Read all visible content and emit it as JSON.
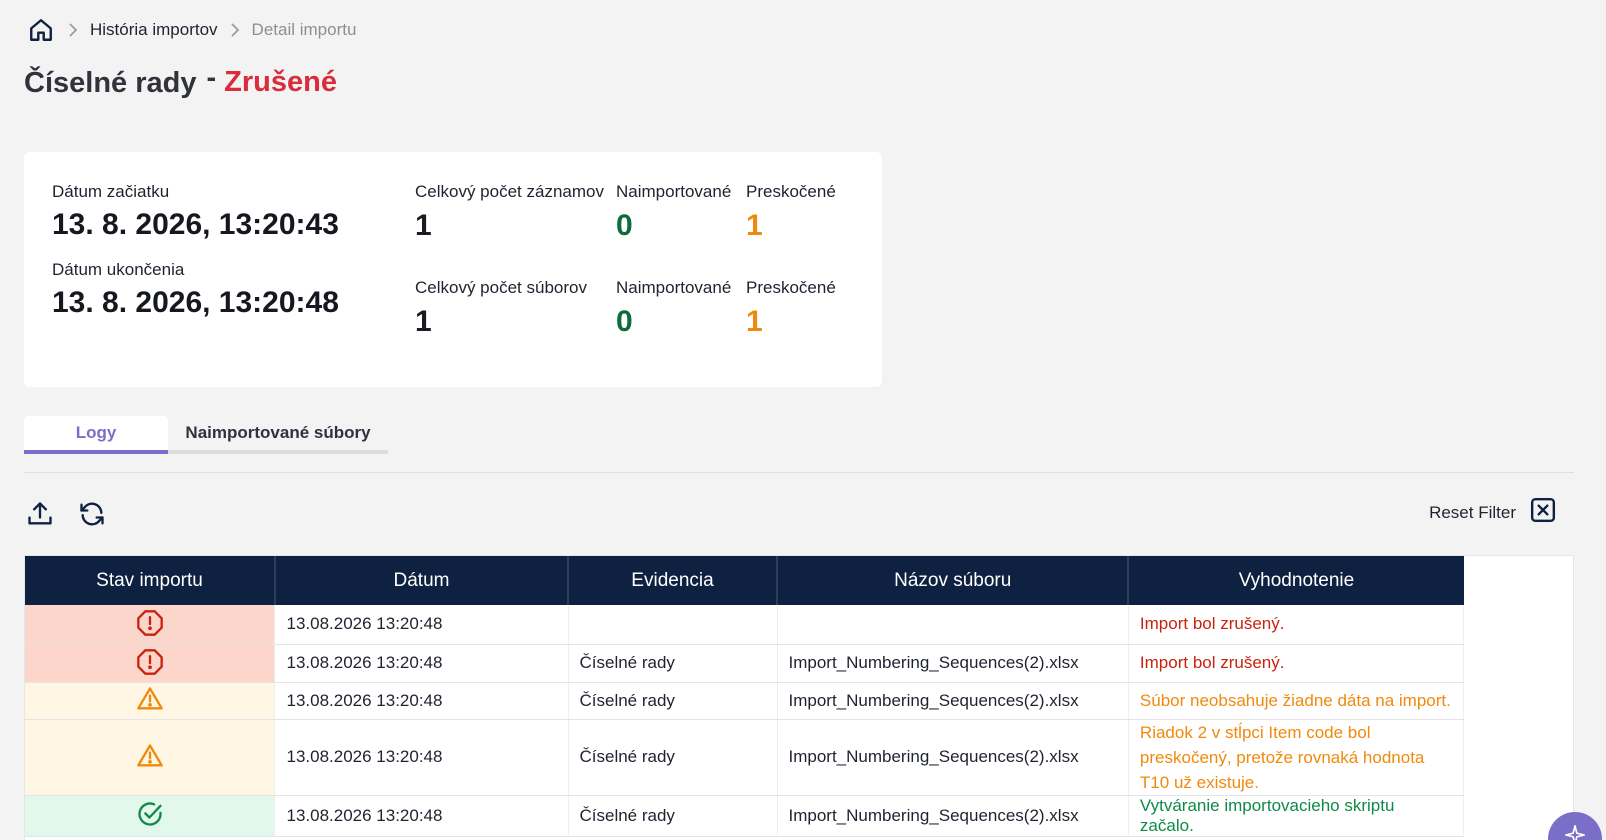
{
  "breadcrumb": {
    "home_icon": "home-icon",
    "items": [
      "História importov",
      "Detail importu"
    ]
  },
  "header": {
    "title": "Číselné rady",
    "separator": "-",
    "status": "Zrušené",
    "status_color": "#d92c3c"
  },
  "summary": {
    "start_label": "Dátum začiatku",
    "start_value": "13. 8. 2026, 13:20:43",
    "end_label": "Dátum ukončenia",
    "end_value": "13. 8. 2026, 13:20:48",
    "records": {
      "total_label": "Celkový počet záznamov",
      "total_value": "1",
      "imported_label": "Naimportované",
      "imported_value": "0",
      "skipped_label": "Preskočené",
      "skipped_value": "1"
    },
    "files": {
      "total_label": "Celkový počet súborov",
      "total_value": "1",
      "imported_label": "Naimportované",
      "imported_value": "0",
      "skipped_label": "Preskočené",
      "skipped_value": "1"
    }
  },
  "tabs": [
    {
      "label": "Logy",
      "active": true
    },
    {
      "label": "Naimportované súbory",
      "active": false
    }
  ],
  "toolbar": {
    "export_icon": "upload-icon",
    "refresh_icon": "refresh-icon",
    "reset_filter_label": "Reset Filter",
    "reset_icon": "close-square-icon"
  },
  "table": {
    "headers": [
      "Stav importu",
      "Dátum",
      "Evidencia",
      "Názov súboru",
      "Vyhodnotenie"
    ],
    "rows": [
      {
        "status": "error",
        "icon": "error-icon",
        "date": "13.08.2026 13:20:48",
        "evidencia": "",
        "file": "",
        "evaluation": "Import bol zrušený."
      },
      {
        "status": "error",
        "icon": "error-icon",
        "date": "13.08.2026 13:20:48",
        "evidencia": "Číselné rady",
        "file": "Import_Numbering_Sequences(2).xlsx",
        "evaluation": "Import bol zrušený."
      },
      {
        "status": "warn",
        "icon": "warning-icon",
        "date": "13.08.2026 13:20:48",
        "evidencia": "Číselné rady",
        "file": "Import_Numbering_Sequences(2).xlsx",
        "evaluation": "Súbor neobsahuje žiadne dáta na import."
      },
      {
        "status": "warn",
        "icon": "warning-icon",
        "date": "13.08.2026 13:20:48",
        "evidencia": "Číselné rady",
        "file": "Import_Numbering_Sequences(2).xlsx",
        "evaluation": "Riadok 2 v stĺpci Item code bol preskočený, pretože rovnaká hodnota T10 už existuje."
      },
      {
        "status": "ok",
        "icon": "check-circle-icon",
        "date": "13.08.2026 13:20:48",
        "evidencia": "Číselné rady",
        "file": "Import_Numbering_Sequences(2).xlsx",
        "evaluation": "Vytváranie importovacieho skriptu začalo."
      }
    ]
  },
  "fab": {
    "icon": "sparkle-icon",
    "color": "#7b6ec8"
  }
}
